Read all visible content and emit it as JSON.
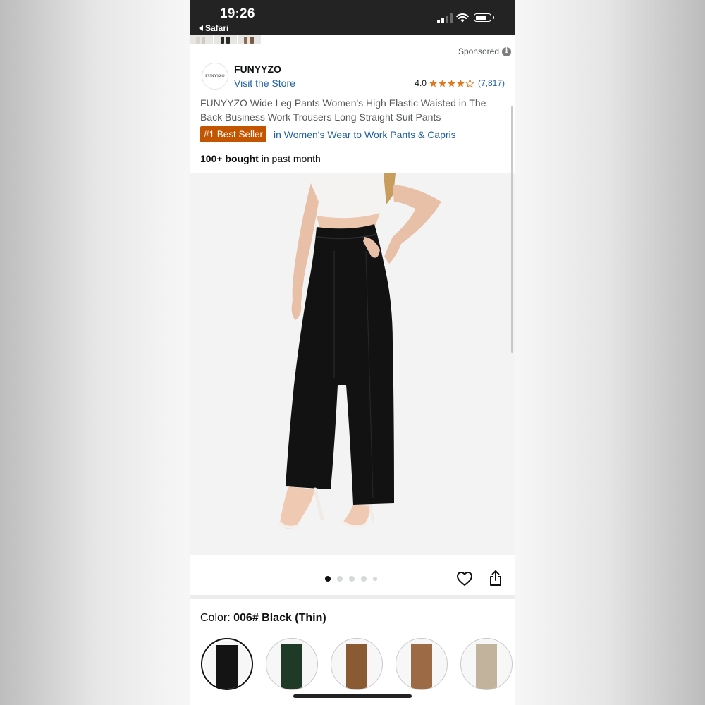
{
  "status_bar": {
    "time": "19:26",
    "back_app": "Safari",
    "icons": [
      "cellular-signal-icon",
      "wifi-icon",
      "battery-icon"
    ]
  },
  "listing": {
    "sponsored_label": "Sponsored",
    "info_icon_glyph": "i",
    "brand": {
      "logo_text": "FUNYYZO",
      "name": "FUNYYZO",
      "visit_store": "Visit the Store"
    },
    "rating": {
      "value": "4.0",
      "stars_filled": 4,
      "stars_total": 5,
      "count": "(7,817)",
      "star_color": "#de7921"
    },
    "title": "FUNYYZO Wide Leg Pants Women's High Elastic Waisted in The Back Business Work Trousers Long Straight Suit Pants",
    "badge": {
      "label": "#1 Best Seller",
      "category": "in Women's Wear to Work Pants & Capris",
      "color": "#c45500"
    },
    "bought": {
      "bold": "100+ bought",
      "rest": " in past month"
    }
  },
  "gallery": {
    "image_count": 5,
    "active_index": 0,
    "actions": [
      "heart-icon",
      "share-icon"
    ]
  },
  "color_selector": {
    "label": "Color: ",
    "selected": "006# Black (Thin)",
    "swatches": [
      {
        "name": "black",
        "color": "#141414",
        "selected": true
      },
      {
        "name": "dark-green",
        "color": "#1f3a26",
        "selected": false
      },
      {
        "name": "brown",
        "color": "#8a5a33",
        "selected": false
      },
      {
        "name": "camel",
        "color": "#9c6b45",
        "selected": false
      },
      {
        "name": "khaki",
        "color": "#c2b39c",
        "selected": false
      }
    ]
  },
  "colors": {
    "link": "#2162a1",
    "text": "#0f1111",
    "secondary_text": "#565959"
  }
}
